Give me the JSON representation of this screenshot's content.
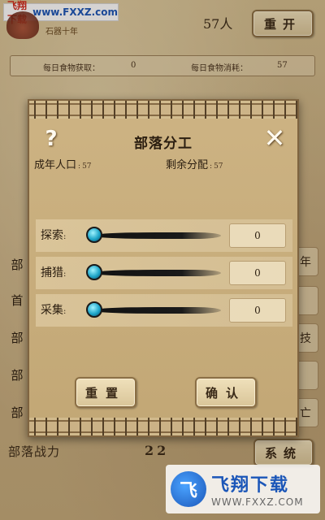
{
  "watermark_top": {
    "part1": "飞翔下载",
    "part2": "www.FXXZ.com"
  },
  "header": {
    "era": "石器十年",
    "population": "57人",
    "restart_label": "重开"
  },
  "food": {
    "income_label": "每日食物获取：",
    "income_value": "0",
    "cost_label": "每日食物消耗：",
    "cost_value": "57"
  },
  "background_rows": {
    "labels": [
      "部",
      "首",
      "部",
      "部",
      "部"
    ],
    "right_tabs": [
      "年",
      "",
      "技",
      "",
      "亡"
    ]
  },
  "footer": {
    "power_label": "部落战力",
    "power_value": "22",
    "system_label": "系统"
  },
  "dialog": {
    "title": "部落分工",
    "help_glyph": "?",
    "close_glyph": "✕",
    "adult_label": "成年人口",
    "adult_value": "57",
    "remain_label": "剩余分配",
    "remain_value": "57",
    "jobs": [
      {
        "label": "探索",
        "value": "0",
        "fraction": 0
      },
      {
        "label": "捕猎",
        "value": "0",
        "fraction": 0
      },
      {
        "label": "采集",
        "value": "0",
        "fraction": 0
      }
    ],
    "reset_label": "重置",
    "confirm_label": "确认"
  },
  "watermark_bottom": {
    "logo": "飞",
    "big": "飞翔下载",
    "small": "WWW.FXXZ.COM"
  },
  "colors": {
    "parchment": "#cdb383",
    "slider_handle": "#1fa6c9",
    "watermark_blue": "#1b56b8",
    "watermark_red": "#d22a1e"
  }
}
